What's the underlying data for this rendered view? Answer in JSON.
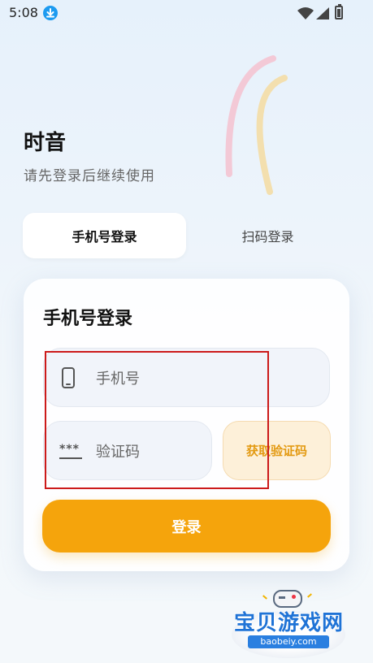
{
  "status_bar": {
    "time": "5:08"
  },
  "app": {
    "title": "时音",
    "subtitle": "请先登录后继续使用"
  },
  "tabs": [
    {
      "label": "手机号登录",
      "active": true
    },
    {
      "label": "扫码登录",
      "active": false
    }
  ],
  "form": {
    "title": "手机号登录",
    "phone_placeholder": "手机号",
    "phone_value": "",
    "code_placeholder": "验证码",
    "code_value": "",
    "code_icon_text": "***",
    "get_code_label": "获取验证码",
    "login_label": "登录"
  },
  "watermark": {
    "name": "宝贝游戏网",
    "url": "baobeiy.com"
  },
  "colors": {
    "accent": "#f5a40c",
    "get_code_bg": "#fdf0d9",
    "get_code_text": "#e39a12",
    "highlight": "#cc1a1a",
    "arc_pink": "#f3c9d6",
    "arc_yellow": "#f3dfae"
  },
  "icons": {
    "status_download": "download-icon",
    "status_wifi": "wifi-icon",
    "status_signal": "signal-icon",
    "status_battery": "battery-icon",
    "phone_field": "phone-icon",
    "code_field": "password-dots-icon"
  }
}
